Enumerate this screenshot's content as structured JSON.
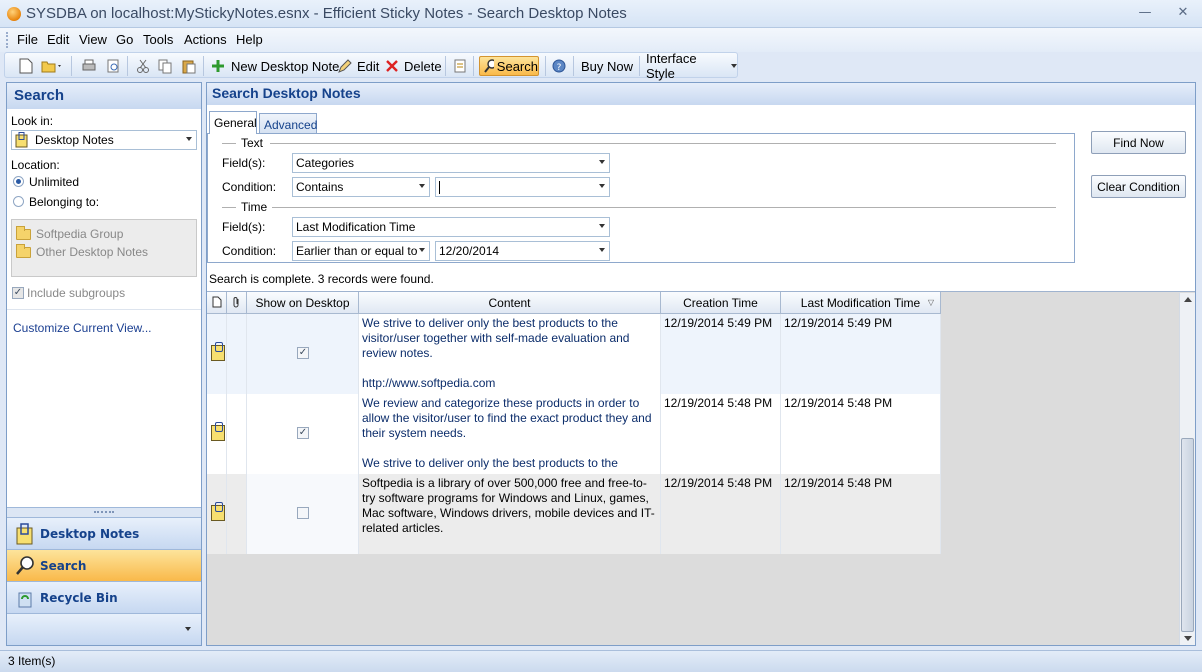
{
  "window": {
    "title": "SYSDBA on localhost:MyStickyNotes.esnx - Efficient Sticky Notes - Search Desktop Notes",
    "minimize": "—",
    "close": "✕"
  },
  "menu": [
    "File",
    "Edit",
    "View",
    "Go",
    "Tools",
    "Actions",
    "Help"
  ],
  "toolbar": {
    "new_note": "New Desktop Note",
    "edit": "Edit",
    "delete": "Delete",
    "search": "Search",
    "buy_now": "Buy Now",
    "interface_style": "Interface Style"
  },
  "left": {
    "header": "Search",
    "look_in_label": "Look in:",
    "look_in_value": "Desktop Notes",
    "location_label": "Location:",
    "unlimited": "Unlimited",
    "belonging_to": "Belonging to:",
    "groups": [
      "Softpedia Group",
      "Other Desktop Notes"
    ],
    "include_subgroups": "Include subgroups",
    "customize_view": "Customize Current View...",
    "nav": [
      "Desktop Notes",
      "Search",
      "Recycle Bin"
    ]
  },
  "main": {
    "header": "Search Desktop Notes",
    "tabs": [
      "General",
      "Advanced"
    ],
    "text_section": "Text",
    "fields_label": "Field(s):",
    "condition_label": "Condition:",
    "text_field_value": "Categories",
    "text_condition_value": "Contains",
    "text_condition_input": "",
    "time_section": "Time",
    "time_field_value": "Last Modification Time",
    "time_condition_value": "Earlier than or equal to",
    "time_date_value": "12/20/2014",
    "find_now": "Find Now",
    "clear_condition": "Clear Condition",
    "status_message": "Search is complete. 3 records were found.",
    "columns": [
      "Show on Desktop",
      "Content",
      "Creation Time",
      "Last Modification Time"
    ],
    "rows": [
      {
        "show": true,
        "content": "We strive to deliver only the best products to the visitor/user together with self-made evaluation and review notes.\n\nhttp://www.softpedia.com",
        "created": "12/19/2014 5:49 PM",
        "modified": "12/19/2014 5:49 PM"
      },
      {
        "show": true,
        "content": "We review and categorize these products in order to allow the visitor/user to find the exact product they and their system needs.\n\nWe strive to deliver only the best products to the",
        "created": "12/19/2014 5:48 PM",
        "modified": "12/19/2014 5:48 PM"
      },
      {
        "show": false,
        "content": "Softpedia is a library of over 500,000 free and free-to-try software programs for Windows and Linux, games, Mac software, Windows drivers, mobile devices and IT-related articles.",
        "created": "12/19/2014 5:48 PM",
        "modified": "12/19/2014 5:48 PM"
      }
    ]
  },
  "status": "3 Item(s)"
}
